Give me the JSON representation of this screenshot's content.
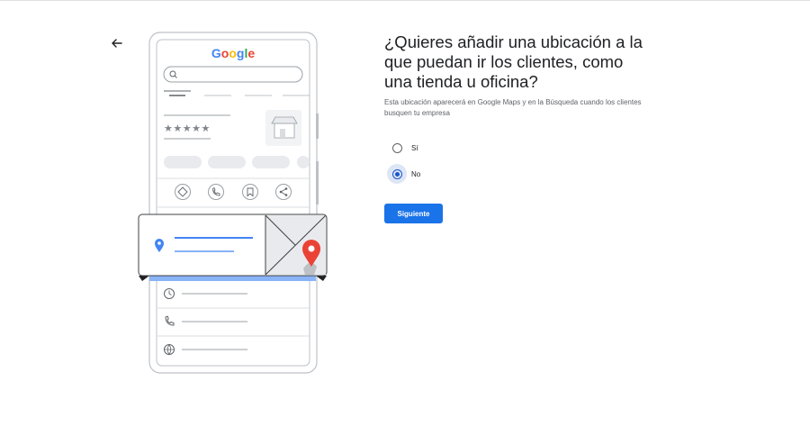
{
  "header": {
    "back_icon": "arrow-back-icon"
  },
  "illustration": {
    "logo_text": "Google",
    "logo_colors": [
      "#4285F4",
      "#EA4335",
      "#FBBC05",
      "#4285F4",
      "#34A853",
      "#EA4335"
    ],
    "rating_stars": "★★★★★"
  },
  "main": {
    "title": "¿Quieres añadir una ubicación a la que puedan ir los clientes, como una tienda u oficina?",
    "description": "Esta ubicación aparecerá en Google Maps y en la Búsqueda cuando los clientes busquen tu empresa",
    "options": [
      {
        "label": "Sí",
        "selected": false
      },
      {
        "label": "No",
        "selected": true
      }
    ],
    "next_label": "Siguiente"
  },
  "colors": {
    "accent": "#1a73e8",
    "radio_selected": "#1a56c7",
    "map_pin": "#EA4335",
    "location_pin": "#4285F4"
  }
}
